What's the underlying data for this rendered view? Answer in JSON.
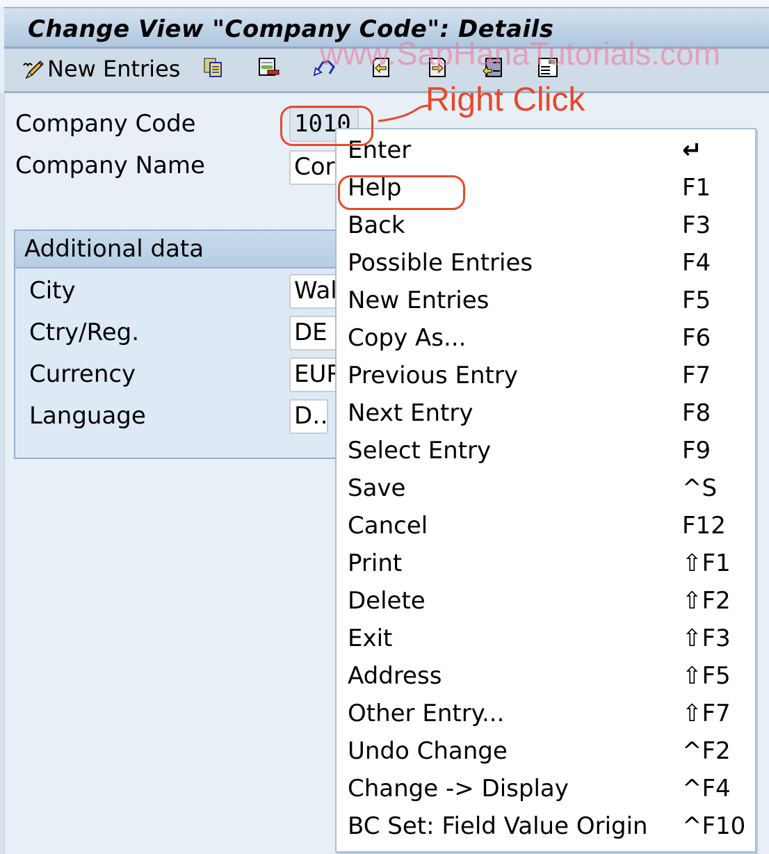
{
  "window": {
    "title": "Change View \"Company Code\": Details"
  },
  "toolbar": {
    "new_entries_label": "New Entries",
    "icons": [
      "new-entries-pencil-icon",
      "copy-as-icon",
      "delete-icon",
      "undo-change-icon",
      "previous-entry-icon",
      "next-entry-icon",
      "other-entry-icon",
      "select-all-icon"
    ]
  },
  "form": {
    "company_code": {
      "label": "Company Code",
      "value": "1010"
    },
    "company_name": {
      "label": "Company Name",
      "value": "Cor"
    },
    "additional_data": {
      "title": "Additional data",
      "fields": [
        {
          "label": "City",
          "value": "Wal"
        },
        {
          "label": "Ctry/Reg.",
          "value": "DE"
        },
        {
          "label": "Currency",
          "value": "EUR"
        },
        {
          "label": "Language",
          "value": "D…"
        }
      ]
    }
  },
  "annotation": {
    "callout_text": "Right Click",
    "watermark": "www.SapHanaTutorials.com",
    "color": "#e8482a"
  },
  "context_menu": {
    "items": [
      {
        "label": "Enter",
        "shortcut": "↵"
      },
      {
        "label": "Help",
        "shortcut": "F1",
        "highlighted": true
      },
      {
        "label": "Back",
        "shortcut": "F3"
      },
      {
        "label": "Possible Entries",
        "shortcut": "F4"
      },
      {
        "label": "New Entries",
        "shortcut": "F5"
      },
      {
        "label": "Copy As...",
        "shortcut": "F6"
      },
      {
        "label": "Previous Entry",
        "shortcut": "F7"
      },
      {
        "label": "Next Entry",
        "shortcut": "F8"
      },
      {
        "label": "Select Entry",
        "shortcut": "F9"
      },
      {
        "label": "Save",
        "shortcut": "^S"
      },
      {
        "label": "Cancel",
        "shortcut": "F12"
      },
      {
        "label": "Print",
        "shortcut": "⇧F1"
      },
      {
        "label": "Delete",
        "shortcut": "⇧F2"
      },
      {
        "label": "Exit",
        "shortcut": "⇧F3"
      },
      {
        "label": "Address",
        "shortcut": "⇧F5"
      },
      {
        "label": "Other Entry...",
        "shortcut": "⇧F7"
      },
      {
        "label": "Undo Change",
        "shortcut": "^F2"
      },
      {
        "label": "Change -> Display",
        "shortcut": "^F4"
      },
      {
        "label": "BC Set: Field Value Origin",
        "shortcut": "^F10"
      }
    ]
  }
}
